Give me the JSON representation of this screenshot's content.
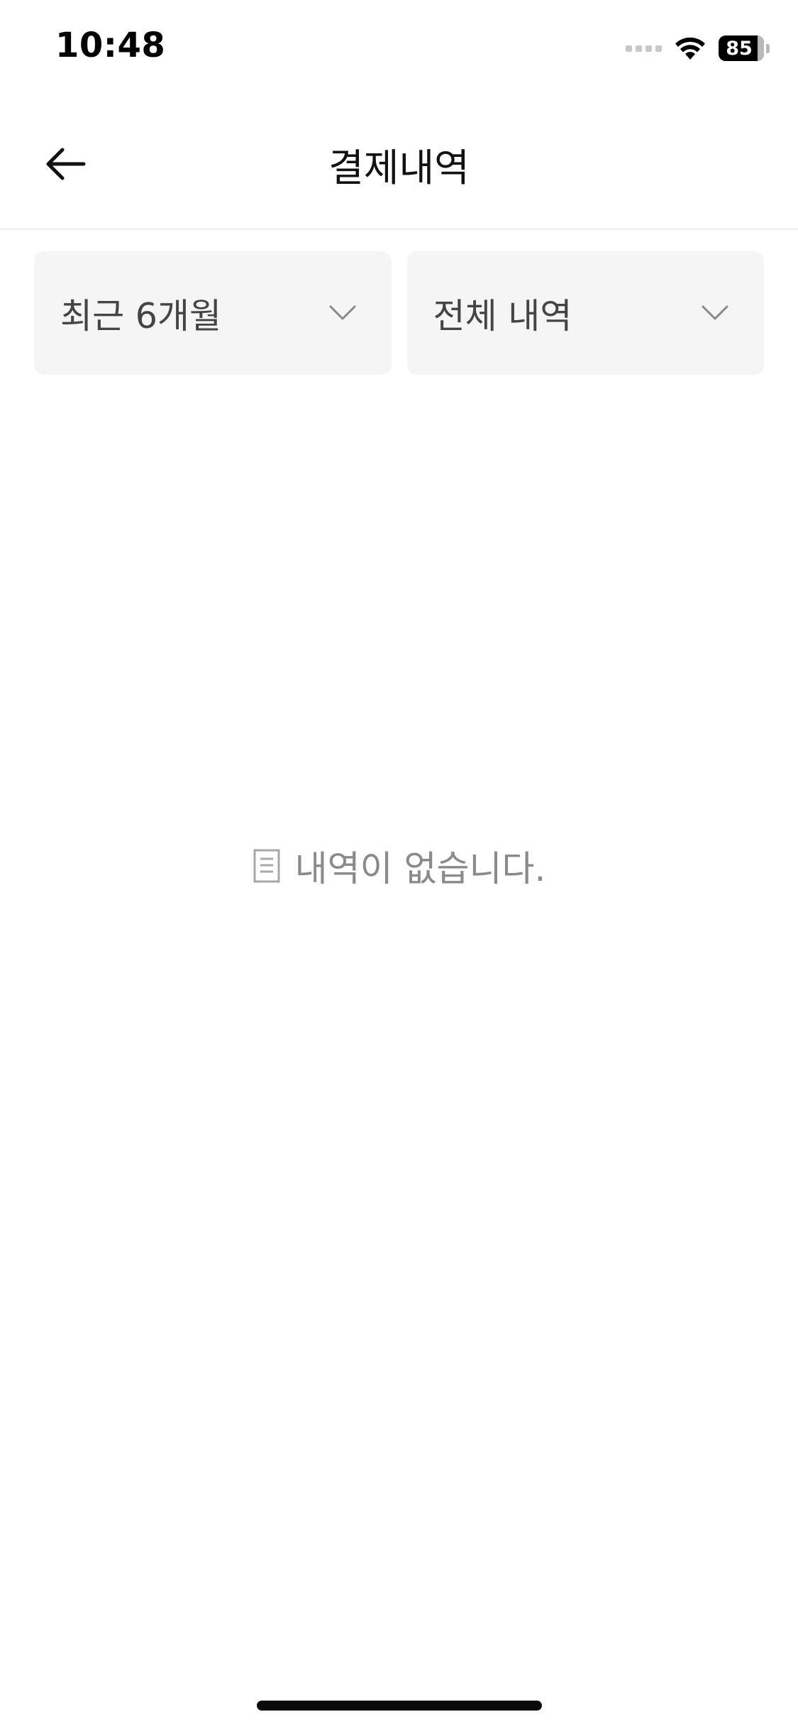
{
  "status_bar": {
    "time": "10:48",
    "battery_level": "85",
    "signal_icon": "cellular-signal-icon",
    "wifi_icon": "wifi-icon"
  },
  "header": {
    "title": "결제내역",
    "back_icon": "arrow-left-icon"
  },
  "filters": {
    "period": {
      "selected": "최근 6개월",
      "icon": "chevron-down-icon"
    },
    "type": {
      "selected": "전체 내역",
      "icon": "chevron-down-icon"
    }
  },
  "empty_state": {
    "icon": "document-icon",
    "message": "내역이 없습니다."
  },
  "colors": {
    "background": "#ffffff",
    "select_background": "#f5f5f5",
    "muted_text": "#8a8a8a",
    "divider": "#efefef"
  }
}
